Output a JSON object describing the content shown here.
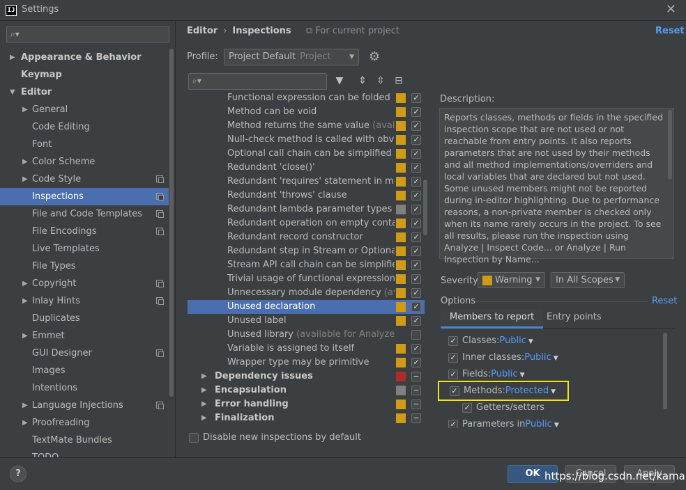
{
  "window": {
    "title": "Settings",
    "app_icon_text": "IJ"
  },
  "sidebar": {
    "search_placeholder": "",
    "items": [
      {
        "label": "Appearance & Behavior",
        "level": 0,
        "arrow": "▶",
        "bold": true
      },
      {
        "label": "Keymap",
        "level": 0,
        "arrow": "",
        "bold": true
      },
      {
        "label": "Editor",
        "level": 0,
        "arrow": "▼",
        "bold": true
      },
      {
        "label": "General",
        "level": 1,
        "arrow": "▶"
      },
      {
        "label": "Code Editing",
        "level": 1,
        "arrow": ""
      },
      {
        "label": "Font",
        "level": 1,
        "arrow": ""
      },
      {
        "label": "Color Scheme",
        "level": 1,
        "arrow": "▶"
      },
      {
        "label": "Code Style",
        "level": 1,
        "arrow": "▶",
        "copy": true
      },
      {
        "label": "Inspections",
        "level": 1,
        "arrow": "",
        "copy": true,
        "selected": true
      },
      {
        "label": "File and Code Templates",
        "level": 1,
        "arrow": "",
        "copy": true
      },
      {
        "label": "File Encodings",
        "level": 1,
        "arrow": "",
        "copy": true
      },
      {
        "label": "Live Templates",
        "level": 1,
        "arrow": ""
      },
      {
        "label": "File Types",
        "level": 1,
        "arrow": ""
      },
      {
        "label": "Copyright",
        "level": 1,
        "arrow": "▶",
        "copy": true
      },
      {
        "label": "Inlay Hints",
        "level": 1,
        "arrow": "▶",
        "copy": true
      },
      {
        "label": "Duplicates",
        "level": 1,
        "arrow": ""
      },
      {
        "label": "Emmet",
        "level": 1,
        "arrow": "▶"
      },
      {
        "label": "GUI Designer",
        "level": 1,
        "arrow": "",
        "copy": true
      },
      {
        "label": "Images",
        "level": 1,
        "arrow": ""
      },
      {
        "label": "Intentions",
        "level": 1,
        "arrow": ""
      },
      {
        "label": "Language Injections",
        "level": 1,
        "arrow": "▶",
        "copy": true
      },
      {
        "label": "Proofreading",
        "level": 1,
        "arrow": "▶"
      },
      {
        "label": "TextMate Bundles",
        "level": 1,
        "arrow": ""
      },
      {
        "label": "TODO",
        "level": 1,
        "arrow": ""
      }
    ]
  },
  "header": {
    "crumb1": "Editor",
    "crumb_sep": "›",
    "crumb2": "Inspections",
    "scope_note": "⧉ For current project",
    "reset": "Reset"
  },
  "profile": {
    "label": "Profile:",
    "value": "Project Default",
    "sub": "Project"
  },
  "inspections": {
    "search_placeholder": "",
    "rows": [
      {
        "text": "Functional expression can be folded",
        "avail": "",
        "sev": "#d09b16",
        "check": "✓"
      },
      {
        "text": "Method can be void",
        "avail": "",
        "sev": "#d09b16",
        "check": "✓"
      },
      {
        "text": "Method returns the same value ",
        "avail": "(available",
        "sev": "#d09b16",
        "check": "✓"
      },
      {
        "text": "Null-check method is called with obvious",
        "avail": "",
        "sev": "#d09b16",
        "check": "✓"
      },
      {
        "text": "Optional call chain can be simplified",
        "avail": "",
        "sev": "#d09b16",
        "check": "✓"
      },
      {
        "text": "Redundant 'close()'",
        "avail": "",
        "sev": "#d09b16",
        "check": "✓"
      },
      {
        "text": "Redundant 'requires' statement in module",
        "avail": "",
        "sev": "#d09b16",
        "check": "✓"
      },
      {
        "text": "Redundant 'throws' clause",
        "avail": "",
        "sev": "#d09b16",
        "check": "✓"
      },
      {
        "text": "Redundant lambda parameter types",
        "avail": "",
        "sev": "#808080",
        "check": "✓"
      },
      {
        "text": "Redundant operation on empty container",
        "avail": "",
        "sev": "#d09b16",
        "check": "✓"
      },
      {
        "text": "Redundant record constructor",
        "avail": "",
        "sev": "#d09b16",
        "check": "✓"
      },
      {
        "text": "Redundant step in Stream or Optional ca",
        "avail": "",
        "sev": "#d09b16",
        "check": "✓"
      },
      {
        "text": "Stream API call chain can be simplified",
        "avail": "",
        "sev": "#d09b16",
        "check": "✓"
      },
      {
        "text": "Trivial usage of functional expression",
        "avail": "",
        "sev": "#d09b16",
        "check": "✓"
      },
      {
        "text": "Unnecessary module dependency ",
        "avail": "(availal",
        "sev": "#d09b16",
        "check": "✓"
      },
      {
        "text": "Unused declaration",
        "avail": "",
        "sev": "#d09b16",
        "check": "✓",
        "selected": true
      },
      {
        "text": "Unused label",
        "avail": "",
        "sev": "#d09b16",
        "check": "✓"
      },
      {
        "text": "Unused library ",
        "avail": "(available for Analyze|Insp",
        "sev": "",
        "check": ""
      },
      {
        "text": "Variable is assigned to itself",
        "avail": "",
        "sev": "#d09b16",
        "check": "✓"
      },
      {
        "text": "Wrapper type may be primitive",
        "avail": "",
        "sev": "#d09b16",
        "check": "✓"
      },
      {
        "text": "Dependency issues",
        "group": true,
        "sev": "#b02a2a",
        "check": "−"
      },
      {
        "text": "Encapsulation",
        "group": true,
        "sev": "#808080",
        "check": "−"
      },
      {
        "text": "Error handling",
        "group": true,
        "sev": "#d09b16",
        "check": "−"
      },
      {
        "text": "Finalization",
        "group": true,
        "sev": "#d09b16",
        "check": "−"
      }
    ],
    "disable_label": "Disable new inspections by default"
  },
  "description": {
    "label": "Description:",
    "text": "Reports classes, methods or fields in the specified inspection scope that are not used or not reachable from entry points. It also reports parameters that are not used by their methods and all method implementations/overriders and local variables that are declared but not used. Some unused members might not be reported during in-editor highlighting. Due to performance reasons, a non-private member is checked only when its name rarely occurs in the project. To see all results, please run the inspection using Analyze | Inspect Code... or Analyze | Run Inspection by Name..."
  },
  "severity": {
    "label": "Severity:",
    "value": "Warning",
    "color": "#d09b16",
    "scope": "In All Scopes"
  },
  "options": {
    "label": "Options",
    "reset": "Reset",
    "tabs": [
      "Members to report",
      "Entry points"
    ],
    "classes": {
      "label": "Classes:",
      "value": "Public"
    },
    "inner": {
      "label": "Inner classes:",
      "value": "Public"
    },
    "fields": {
      "label": "Fields:",
      "value": "Public"
    },
    "methods": {
      "label": "Methods:",
      "value": "Protected"
    },
    "getters": {
      "label": "Getters/setters"
    },
    "parameters": {
      "label": "Parameters in",
      "value": "Public"
    }
  },
  "footer": {
    "help": "?",
    "ok": "OK",
    "cancel": "Cancel",
    "apply": "Apply",
    "watermark": "https://blog.csdn.net/kamarl"
  }
}
